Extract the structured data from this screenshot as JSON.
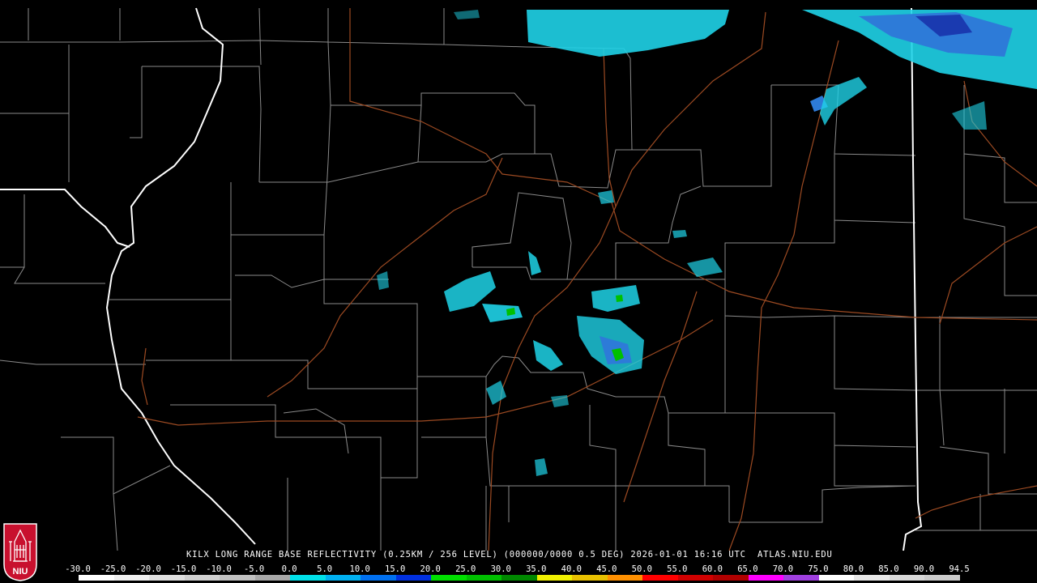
{
  "title": "KILX LONG RANGE BASE REFLECTIVITY (0.25KM / 256 LEVEL) (000000/0000 0.5 DEG) 2026-01-01 16:16 UTC  ATLAS.NIU.EDU",
  "logo": {
    "text": "NIU",
    "icon": "university-tower-icon",
    "color": "#c8102e"
  },
  "scale": {
    "labels": [
      "-30.0",
      "-25.0",
      "-20.0",
      "-15.0",
      "-10.0",
      "-5.0",
      "0.0",
      "5.0",
      "10.0",
      "15.0",
      "20.0",
      "25.0",
      "30.0",
      "35.0",
      "40.0",
      "45.0",
      "50.0",
      "55.0",
      "60.0",
      "65.0",
      "70.0",
      "75.0",
      "80.0",
      "85.0",
      "90.0",
      "94.5"
    ],
    "colors": [
      "#ffffff",
      "#f0f0f0",
      "#e0e0e0",
      "#d0d0d0",
      "#c0c0c0",
      "#a8a8a8",
      "#00e0e8",
      "#00b0f0",
      "#0070f0",
      "#0030e0",
      "#00e000",
      "#00c000",
      "#008800",
      "#f0f000",
      "#e8c000",
      "#ff9000",
      "#ff0000",
      "#d00000",
      "#b00000",
      "#ff00ff",
      "#a040e0",
      "#ffffff",
      "#e8e8e8",
      "#d8d8d8",
      "#cccccc"
    ]
  },
  "colors": {
    "background": "#000000",
    "county_lines": "#8a8a8a",
    "state_lines": "#ffffff",
    "roads": "#9c4a22",
    "echo_light": "#1fd3e8",
    "echo_mid": "#2d7bd8",
    "echo_strong": "#1a3ab0",
    "echo_core": "#00c000"
  }
}
